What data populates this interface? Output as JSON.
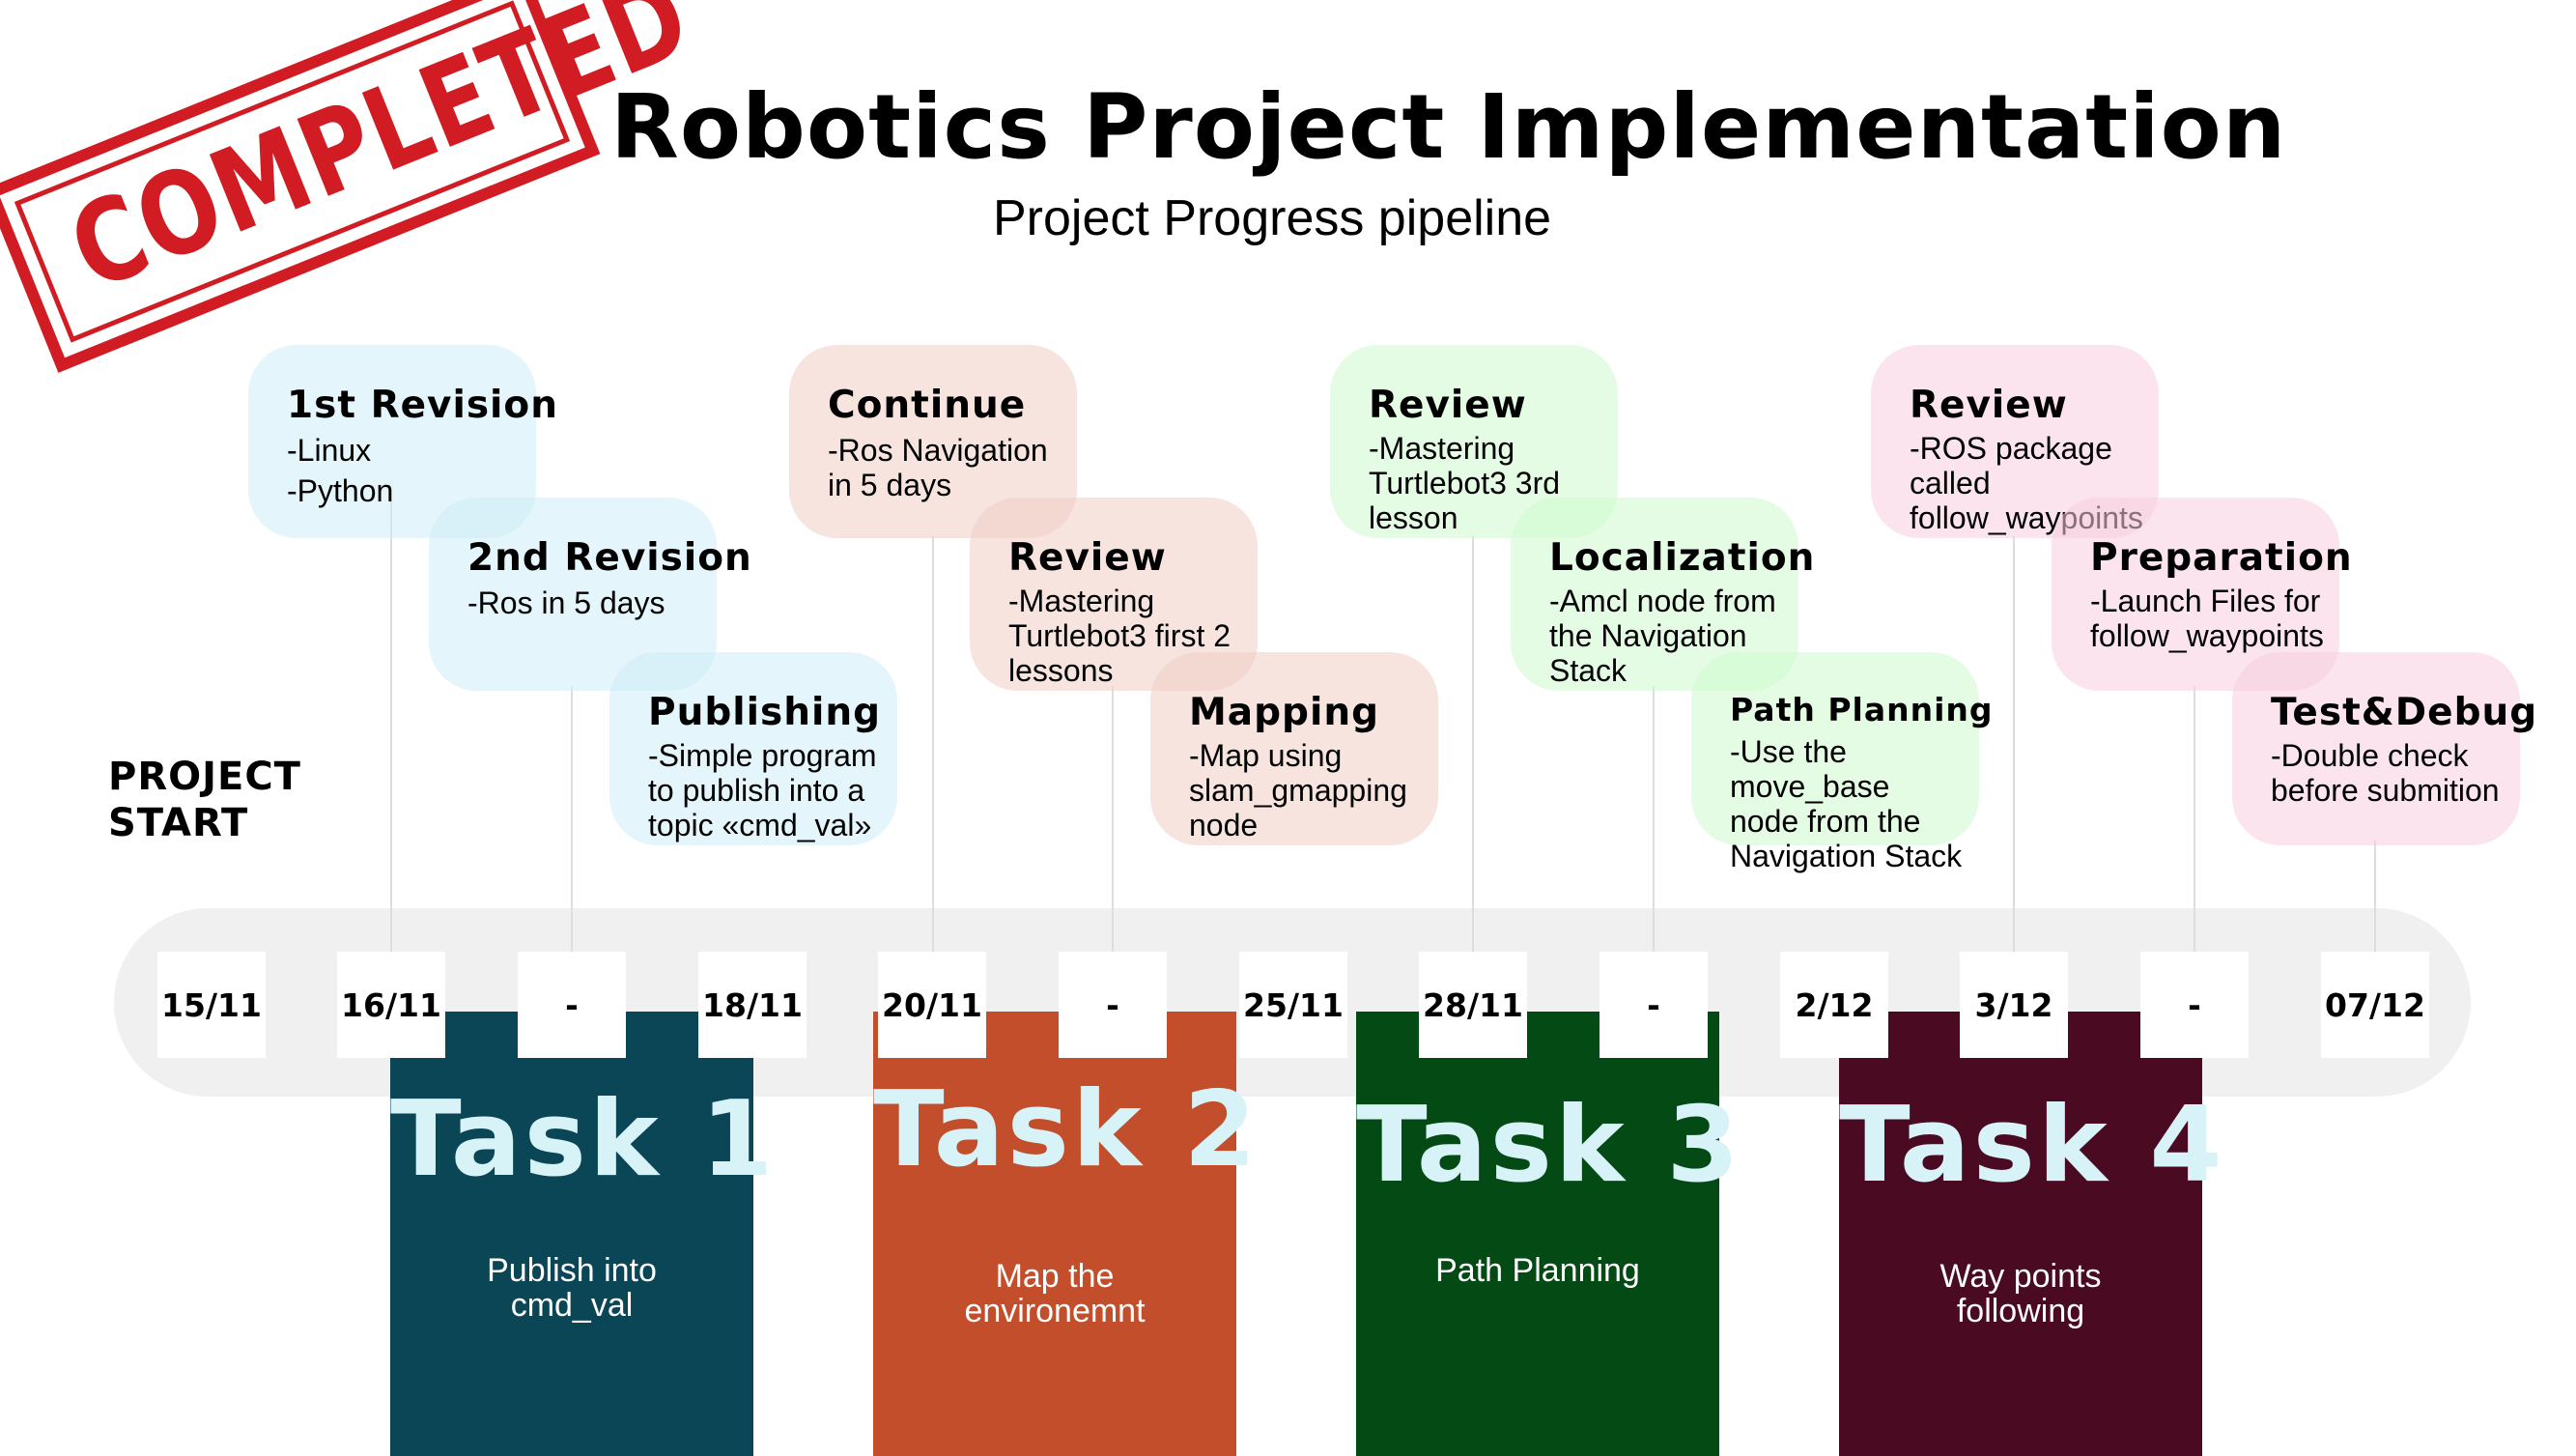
{
  "header": {
    "title": "Robotics Project Implementation",
    "subtitle": "Project Progress pipeline",
    "stamp": "COMPLETED",
    "start_label": [
      "PROJECT",
      "START"
    ]
  },
  "colors": {
    "task1": "#0b4656",
    "task2": "#c24e2c",
    "task3": "#034a15",
    "task4": "#4a0b22",
    "stamp": "#d01c22",
    "track": "#f0f0f0"
  },
  "timeline": {
    "dates": [
      "15/11",
      "16/11",
      "-",
      "18/11",
      "20/11",
      "-",
      "25/11",
      "28/11",
      "-",
      "2/12",
      "3/12",
      "-",
      "07/12"
    ]
  },
  "milestones": [
    {
      "title": "1st Revision",
      "lines": [
        "-Linux",
        "-Python"
      ]
    },
    {
      "title": "2nd Revision",
      "lines": [
        "-Ros in 5 days"
      ]
    },
    {
      "title": "Publishing",
      "lines": [
        "-Simple program",
        "to publish into a",
        "topic «cmd_val»"
      ]
    },
    {
      "title": "Continue",
      "lines": [
        "-Ros Navigation",
        "in 5 days"
      ]
    },
    {
      "title": "Review",
      "lines": [
        "-Mastering",
        "Turtlebot3 first 2",
        "lessons"
      ]
    },
    {
      "title": "Mapping",
      "lines": [
        "-Map using",
        "slam_gmapping",
        "node"
      ]
    },
    {
      "title": "Review",
      "lines": [
        "-Mastering",
        "Turtlebot3 3rd",
        "lesson"
      ]
    },
    {
      "title": "Localization",
      "lines": [
        "-Amcl node from",
        "the Navigation",
        "Stack"
      ]
    },
    {
      "title": "Path Planning",
      "lines": [
        "-Use the",
        "move_base",
        "node from the",
        "Navigation Stack"
      ]
    },
    {
      "title": "Review",
      "lines": [
        "-ROS package",
        "called",
        "follow_waypoints"
      ]
    },
    {
      "title": "Preparation",
      "lines": [
        "-Launch Files for",
        "follow_waypoints"
      ]
    },
    {
      "title": "Test&Debug",
      "lines": [
        "-Double check",
        "before submition"
      ]
    }
  ],
  "tasks": [
    {
      "name": "Task 1",
      "desc": [
        "Publish into",
        "cmd_val"
      ]
    },
    {
      "name": "Task 2",
      "desc": [
        "Map the",
        "environemnt"
      ]
    },
    {
      "name": "Task 3",
      "desc": [
        "Path Planning"
      ]
    },
    {
      "name": "Task 4",
      "desc": [
        "Way points",
        "following"
      ]
    }
  ]
}
